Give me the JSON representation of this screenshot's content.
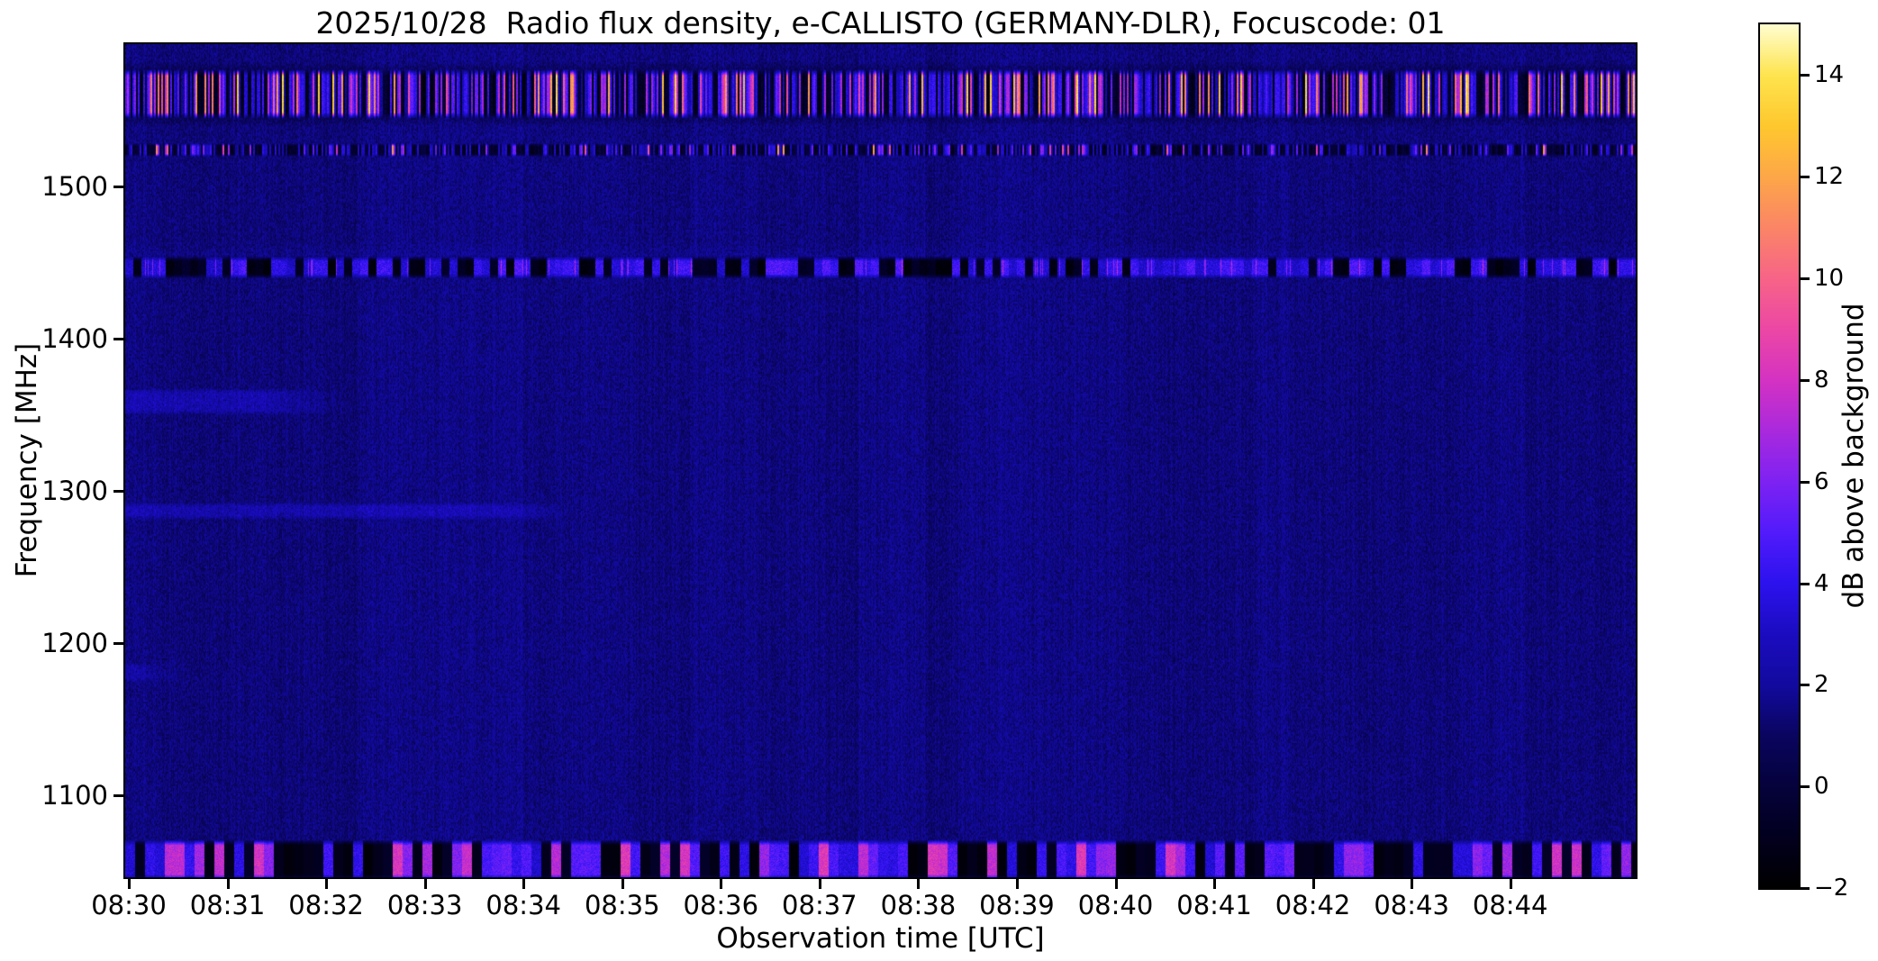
{
  "figure": {
    "background_color": "#ffffff"
  },
  "chart_data": {
    "type": "heatmap",
    "subtype": "radio-spectrogram",
    "title": "2025/10/28  Radio flux density, e-CALLISTO (GERMANY-DLR), Focuscode: 01",
    "xlabel": "Observation time [UTC]",
    "ylabel": "Frequency [MHz]",
    "x_ticks": [
      "08:30",
      "08:31",
      "08:32",
      "08:33",
      "08:34",
      "08:35",
      "08:36",
      "08:37",
      "08:38",
      "08:39",
      "08:40",
      "08:41",
      "08:42",
      "08:43",
      "08:44"
    ],
    "x_range": [
      "08:30:00",
      "08:45:16"
    ],
    "y_ticks": [
      1500,
      1400,
      1300,
      1200,
      1100
    ],
    "y_range_mhz": [
      1046,
      1593
    ],
    "grid": false,
    "background_level_db": 1.5,
    "background_color_hex": "#0d0886",
    "colorbar": {
      "label": "dB above background",
      "position": "right",
      "range": [
        -2,
        15
      ],
      "ticks": [
        14,
        12,
        10,
        8,
        6,
        4,
        2,
        0,
        -2
      ],
      "colormap": "gnuplot2",
      "stops": [
        [
          0.0,
          "#000000"
        ],
        [
          0.059,
          "#02001e"
        ],
        [
          0.118,
          "#05023c"
        ],
        [
          0.176,
          "#0a055e"
        ],
        [
          0.235,
          "#120a9e"
        ],
        [
          0.294,
          "#1b0cc0"
        ],
        [
          0.353,
          "#2c12ee"
        ],
        [
          0.412,
          "#521bfb"
        ],
        [
          0.471,
          "#7e22f2"
        ],
        [
          0.529,
          "#a929dd"
        ],
        [
          0.588,
          "#d432c2"
        ],
        [
          0.647,
          "#ec47a4"
        ],
        [
          0.706,
          "#f76487"
        ],
        [
          0.765,
          "#fb8566"
        ],
        [
          0.824,
          "#fda748"
        ],
        [
          0.882,
          "#fec72e"
        ],
        [
          0.941,
          "#fee44e"
        ],
        [
          1.0,
          "#fffdd0"
        ]
      ]
    },
    "rfi_bands": [
      {
        "name": "band-1560",
        "f_lo": 1546,
        "f_hi": 1576,
        "style": "streaks-strong",
        "x_start": 0,
        "x_end": 1,
        "peak_db": 14,
        "desc": "strong broadband RFI band: dense vertical streaks alternating black, blue, magenta, pink and orange"
      },
      {
        "name": "band-1524",
        "f_lo": 1520.5,
        "f_hi": 1528,
        "style": "streaks-thin",
        "x_start": 0,
        "x_end": 1,
        "peak_db": 10,
        "desc": "thin speckled RFI line with small blue/red dots"
      },
      {
        "name": "band-1447",
        "f_lo": 1441,
        "f_hi": 1453,
        "style": "segments-blue",
        "x_start": 0,
        "x_end": 1,
        "peak_db": 8,
        "desc": "interrupted band alternating black dropouts and bright blue streaks"
      },
      {
        "name": "band-1359",
        "f_lo": 1352,
        "f_hi": 1366,
        "style": "faint-smear",
        "x_start": 0,
        "x_end": 0.145,
        "peak_db": 3,
        "desc": "faint brighter-blue smear visible only from 08:30 to about 08:32"
      },
      {
        "name": "band-1287",
        "f_lo": 1283,
        "f_hi": 1291,
        "style": "faint-smear",
        "x_start": 0,
        "x_end": 0.3,
        "peak_db": 3,
        "desc": "faint thin brighter-blue line visible until about 08:34.5"
      },
      {
        "name": "band-1181",
        "f_lo": 1176,
        "f_hi": 1186,
        "style": "faint-smear",
        "x_start": 0,
        "x_end": 0.044,
        "peak_db": 3,
        "desc": "very faint brighter smear just after 08:30"
      },
      {
        "name": "band-1058",
        "f_lo": 1047,
        "f_hi": 1071,
        "style": "segments-bottom",
        "x_start": 0,
        "x_end": 1,
        "peak_db": 9,
        "desc": "strong bottom RFI band: black gaps alternating with bright blue-violet and magenta blobs"
      }
    ]
  }
}
